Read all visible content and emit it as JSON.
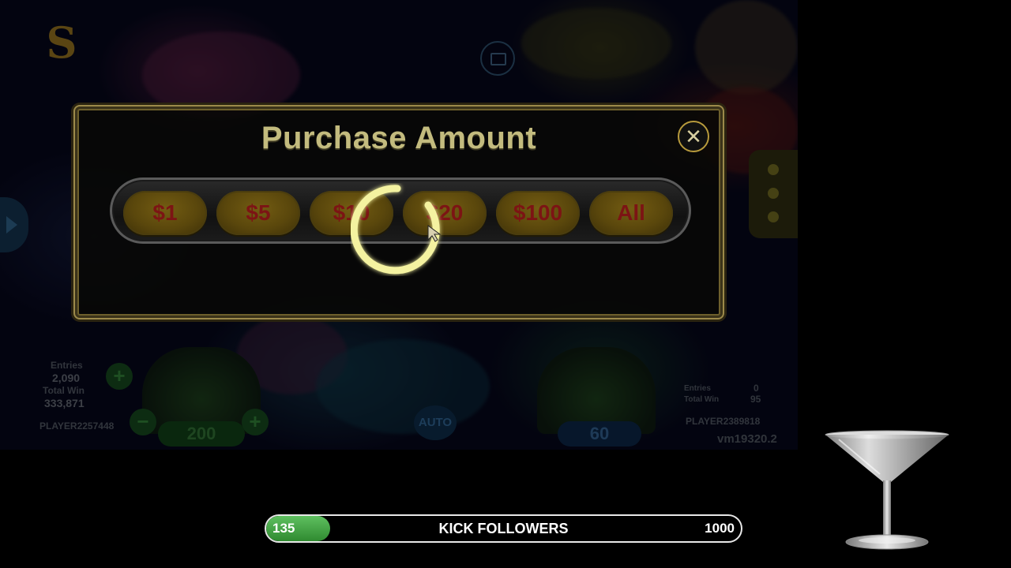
{
  "game": {
    "left_stats": {
      "entries_label": "Entries",
      "entries_value": "2,090",
      "total_win_label": "Total Win",
      "total_win_value": "333,871",
      "player_name": "PLAYER2257448"
    },
    "right_stats": {
      "entries_label": "Entries",
      "entries_value": "0",
      "total_win_label": "Total Win",
      "total_win_value": "95",
      "player_name": "PLAYER2389818"
    },
    "left_bet": "200",
    "right_bet": "60",
    "auto_label": "AUTO",
    "version": "vm19320.2",
    "minus_symbol": "−",
    "plus_symbol": "+"
  },
  "modal": {
    "title": "Purchase Amount",
    "close_symbol": "✕",
    "amounts": [
      "$1",
      "$5",
      "$10",
      "$20",
      "$100",
      "All"
    ],
    "loading": true
  },
  "followers_bar": {
    "current": "135",
    "label": "KICK FOLLOWERS",
    "goal": "1000",
    "progress": 0.135
  },
  "colors": {
    "modal_border": "#9c8a4a",
    "title": "#c3bb7e",
    "amount_text": "#7c1414",
    "spinner": "#f4f2a0",
    "progress_fill": "#3fa040"
  }
}
